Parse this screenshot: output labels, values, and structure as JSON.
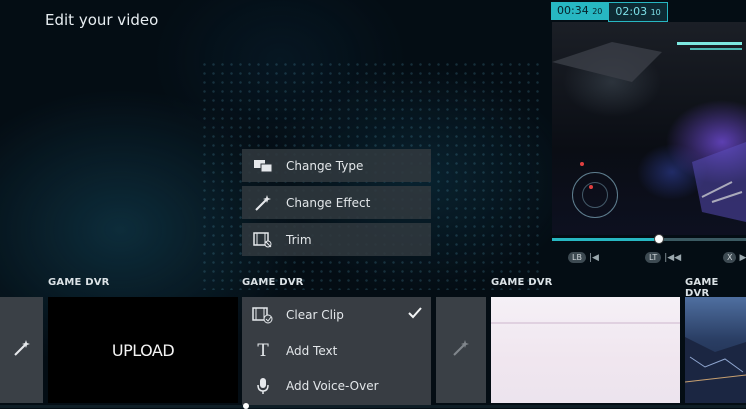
{
  "page": {
    "title": "Edit your video"
  },
  "preview": {
    "current_time": "00:34",
    "current_frames": "20",
    "total_time": "02:03",
    "total_frames": "10",
    "progress": 0.54,
    "controls": [
      {
        "button": "LB",
        "icon": "skip-back-icon"
      },
      {
        "button": "LT",
        "icon": "rewind-icon"
      },
      {
        "button": "X",
        "icon": "skip-forward-icon"
      }
    ]
  },
  "edit_menu": [
    {
      "label": "Change Type",
      "icon": "change-type-icon"
    },
    {
      "label": "Change Effect",
      "icon": "magic-wand-icon"
    },
    {
      "label": "Trim",
      "icon": "trim-icon"
    }
  ],
  "clips": {
    "labels": [
      "GAME DVR",
      "GAME DVR",
      "GAME DVR",
      "GAME DVR"
    ],
    "upload_label": "UPLOAD"
  },
  "context_menu": {
    "items": [
      {
        "label": "Clear Clip",
        "icon": "clear-clip-icon",
        "checked": true
      },
      {
        "label": "Add Text",
        "icon": "text-icon",
        "checked": false
      },
      {
        "label": "Add Voice-Over",
        "icon": "microphone-icon",
        "checked": false
      }
    ]
  },
  "colors": {
    "accent": "#27b7c2",
    "menu_bg": "#30383e",
    "background": "#040d14"
  }
}
